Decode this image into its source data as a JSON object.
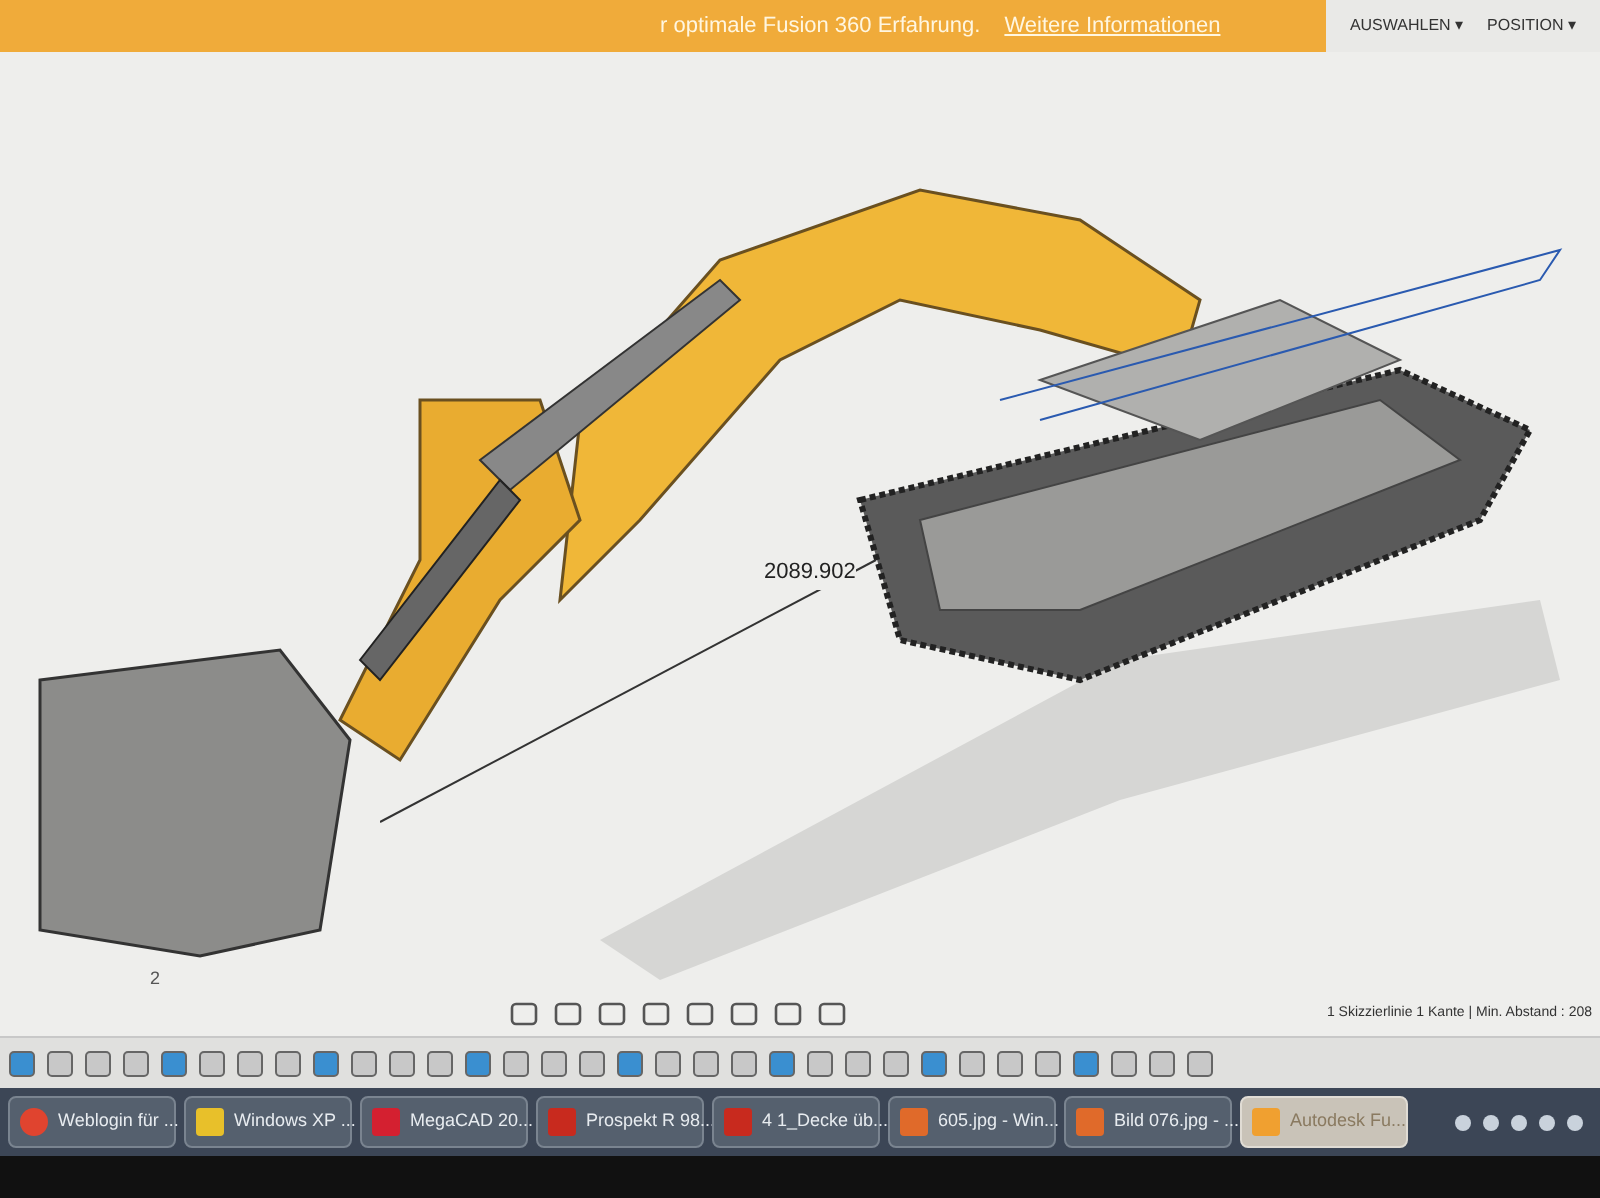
{
  "banner": {
    "text": "r optimale Fusion 360 Erfahrung.",
    "link": "Weitere Informationen"
  },
  "toolbar": {
    "groups": [
      {
        "label": "AUSWAHLEN ▾"
      },
      {
        "label": "POSITION ▾"
      }
    ]
  },
  "canvas": {
    "dimension": "2089.902",
    "point_label": "2"
  },
  "status": {
    "text": "1 Skizzierlinie 1 Kante | Min. Abstand : 208"
  },
  "taskbar": {
    "items": [
      {
        "label": "Weblogin für ...",
        "kind": "browser",
        "selected": false
      },
      {
        "label": "Windows XP ...",
        "kind": "folder",
        "selected": false
      },
      {
        "label": "MegaCAD 20...",
        "kind": "cad",
        "selected": false
      },
      {
        "label": "Prospekt R 98...",
        "kind": "pdf",
        "selected": false
      },
      {
        "label": "4 1_Decke üb...",
        "kind": "pdf",
        "selected": false
      },
      {
        "label": "605.jpg - Win...",
        "kind": "image",
        "selected": false
      },
      {
        "label": "Bild 076.jpg - ...",
        "kind": "image",
        "selected": false
      },
      {
        "label": "Autodesk Fu...",
        "kind": "fusion",
        "selected": true
      }
    ]
  }
}
